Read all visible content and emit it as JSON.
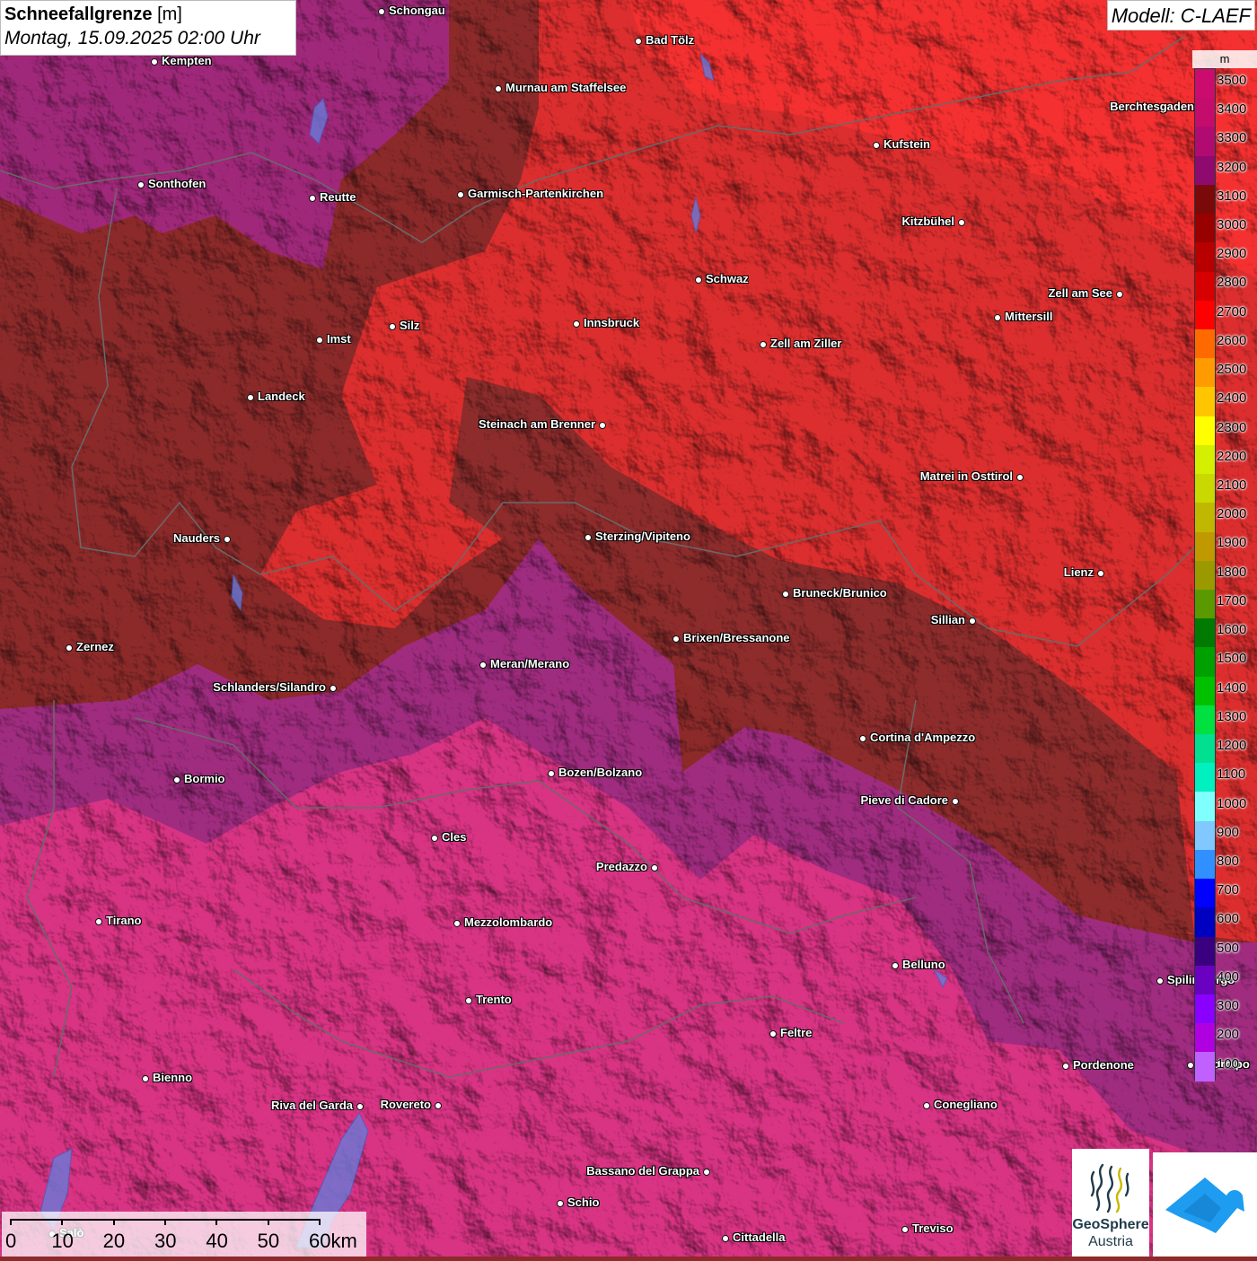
{
  "header": {
    "title_bold": "Schneefallgrenze",
    "title_unit": "[m]",
    "datetime": "Montag, 15.09.2025 02:00 Uhr"
  },
  "model_label": "Modell: C-LAEF",
  "legend": {
    "unit": "m",
    "steps": [
      {
        "value": "3500",
        "color": "#cc0b6e"
      },
      {
        "value": "3400",
        "color": "#c40c6c"
      },
      {
        "value": "3300",
        "color": "#b10b72"
      },
      {
        "value": "3200",
        "color": "#8f0a6f"
      },
      {
        "value": "3100",
        "color": "#7a0a0a"
      },
      {
        "value": "3000",
        "color": "#990000"
      },
      {
        "value": "2900",
        "color": "#b80000"
      },
      {
        "value": "2800",
        "color": "#d60000"
      },
      {
        "value": "2700",
        "color": "#ff0000"
      },
      {
        "value": "2600",
        "color": "#ff6a00"
      },
      {
        "value": "2500",
        "color": "#ff9a00"
      },
      {
        "value": "2400",
        "color": "#ffc600"
      },
      {
        "value": "2300",
        "color": "#ffff00"
      },
      {
        "value": "2200",
        "color": "#d4f000"
      },
      {
        "value": "2100",
        "color": "#c8d800"
      },
      {
        "value": "2000",
        "color": "#c0b800"
      },
      {
        "value": "1900",
        "color": "#c09800"
      },
      {
        "value": "1800",
        "color": "#9a9a00"
      },
      {
        "value": "1700",
        "color": "#5a9a00"
      },
      {
        "value": "1600",
        "color": "#007a00"
      },
      {
        "value": "1500",
        "color": "#00a000"
      },
      {
        "value": "1400",
        "color": "#00c000"
      },
      {
        "value": "1300",
        "color": "#00e040"
      },
      {
        "value": "1200",
        "color": "#00e090"
      },
      {
        "value": "1100",
        "color": "#00f0c0"
      },
      {
        "value": "1000",
        "color": "#80ffff"
      },
      {
        "value": "900",
        "color": "#80c8ff"
      },
      {
        "value": "800",
        "color": "#3090ff"
      },
      {
        "value": "700",
        "color": "#0000ff"
      },
      {
        "value": "600",
        "color": "#0000c0"
      },
      {
        "value": "500",
        "color": "#3a0080"
      },
      {
        "value": "400",
        "color": "#6a00c0"
      },
      {
        "value": "300",
        "color": "#8a00ff"
      },
      {
        "value": "200",
        "color": "#b000e0"
      },
      {
        "value": "100",
        "color": "#c060ff"
      }
    ]
  },
  "scale_bar": {
    "labels": [
      "0",
      "10",
      "20",
      "30",
      "40",
      "50",
      "60km"
    ]
  },
  "logos": {
    "geosphere_line1": "GeoSphere",
    "geosphere_line2": "Austria"
  },
  "cities": [
    {
      "name": "Schongau",
      "side": "right"
    },
    {
      "name": "Bad Tölz",
      "side": "right"
    },
    {
      "name": "Kempten",
      "side": "right"
    },
    {
      "name": "Murnau am Staffelsee",
      "side": "right"
    },
    {
      "name": "Kufstein",
      "side": "right"
    },
    {
      "name": "Berchtesgaden",
      "side": "left"
    },
    {
      "name": "Sonthofen",
      "side": "right"
    },
    {
      "name": "Reutte",
      "side": "right"
    },
    {
      "name": "Garmisch-Partenkirchen",
      "side": "right"
    },
    {
      "name": "Kitzbühel",
      "side": "left"
    },
    {
      "name": "Schwaz",
      "side": "right"
    },
    {
      "name": "Zell am See",
      "side": "left"
    },
    {
      "name": "Innsbruck",
      "side": "right"
    },
    {
      "name": "Mittersill",
      "side": "right"
    },
    {
      "name": "Imst",
      "side": "right"
    },
    {
      "name": "Silz",
      "side": "right"
    },
    {
      "name": "Zell am Ziller",
      "side": "right"
    },
    {
      "name": "Landeck",
      "side": "right"
    },
    {
      "name": "Steinach am Brenner",
      "side": "left"
    },
    {
      "name": "Matrei in Osttirol",
      "side": "left"
    },
    {
      "name": "Nauders",
      "side": "left"
    },
    {
      "name": "Sterzing/Vipiteno",
      "side": "right"
    },
    {
      "name": "Lienz",
      "side": "left"
    },
    {
      "name": "Bruneck/Brunico",
      "side": "right"
    },
    {
      "name": "Sillian",
      "side": "left"
    },
    {
      "name": "Brixen/Bressanone",
      "side": "right"
    },
    {
      "name": "Zernez",
      "side": "right"
    },
    {
      "name": "Meran/Merano",
      "side": "right"
    },
    {
      "name": "Schlanders/Silandro",
      "side": "left"
    },
    {
      "name": "Cortina d'Ampezzo",
      "side": "right"
    },
    {
      "name": "Bormio",
      "side": "right"
    },
    {
      "name": "Bozen/Bolzano",
      "side": "right"
    },
    {
      "name": "Pieve di Cadore",
      "side": "left"
    },
    {
      "name": "Cles",
      "side": "right"
    },
    {
      "name": "Predazzo",
      "side": "left"
    },
    {
      "name": "Tirano",
      "side": "right"
    },
    {
      "name": "Mezzolombardo",
      "side": "right"
    },
    {
      "name": "Belluno",
      "side": "right"
    },
    {
      "name": "Spilimbergo",
      "side": "right"
    },
    {
      "name": "Trento",
      "side": "right"
    },
    {
      "name": "Feltre",
      "side": "right"
    },
    {
      "name": "Pordenone",
      "side": "right"
    },
    {
      "name": "Codroipo",
      "side": "right"
    },
    {
      "name": "Bienno",
      "side": "right"
    },
    {
      "name": "Riva del Garda",
      "side": "left"
    },
    {
      "name": "Rovereto",
      "side": "left"
    },
    {
      "name": "Conegliano",
      "side": "right"
    },
    {
      "name": "Bassano del Grappa",
      "side": "left"
    },
    {
      "name": "Schio",
      "side": "right"
    },
    {
      "name": "Salò",
      "side": "right"
    },
    {
      "name": "Treviso",
      "side": "right"
    },
    {
      "name": "Cittadella",
      "side": "right"
    }
  ]
}
